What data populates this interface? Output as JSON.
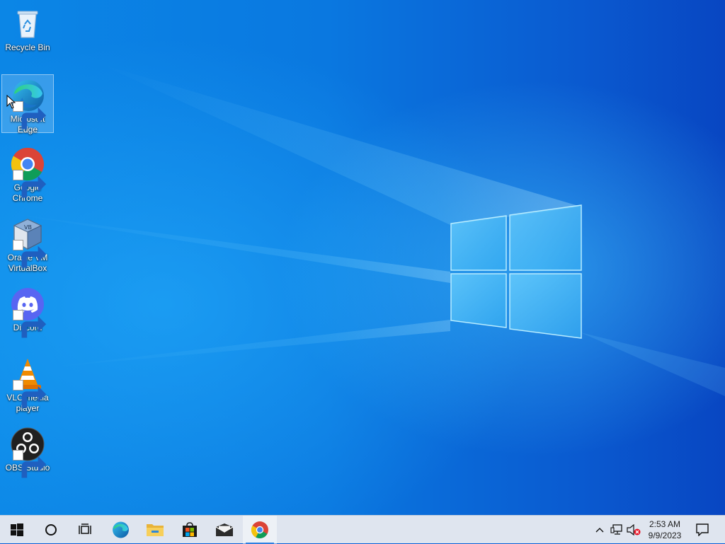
{
  "desktop": {
    "icons": [
      {
        "label": "Recycle Bin",
        "icon": "recycle-bin-icon"
      },
      {
        "label": "Microsoft Edge",
        "icon": "edge-icon"
      },
      {
        "label": "Google Chrome",
        "icon": "chrome-icon"
      },
      {
        "label": "Oracle VM VirtualBox",
        "icon": "virtualbox-icon"
      },
      {
        "label": "Discord",
        "icon": "discord-icon"
      },
      {
        "label": "VLC media player",
        "icon": "vlc-icon"
      },
      {
        "label": "OBS Studio",
        "icon": "obs-icon"
      }
    ],
    "selected_icon": "Microsoft Edge"
  },
  "taskbar": {
    "pinned": [
      "start-icon",
      "search-circle-icon",
      "task-view-icon",
      "edge-icon",
      "file-explorer-icon",
      "store-icon",
      "mail-icon",
      "chrome-icon"
    ],
    "active_app": "chrome-icon",
    "clock": {
      "time": "2:53 AM",
      "date": "9/9/2023"
    }
  },
  "colors": {
    "taskbar": "#dfe5ef",
    "accent": "#2f7fe0",
    "wallpaper": "#0a78e0"
  }
}
